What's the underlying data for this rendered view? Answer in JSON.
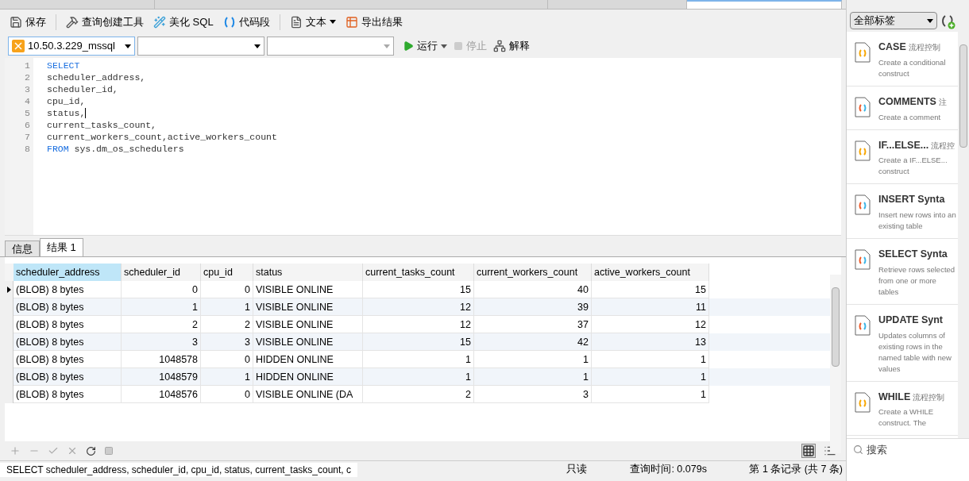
{
  "document_tabs": [
    {
      "selected": false
    },
    {
      "selected": false
    },
    {
      "selected": false
    },
    {
      "selected": true
    }
  ],
  "toolbar": [
    {
      "label": "保存",
      "kind": "save",
      "dropdown": false
    },
    {
      "label": "查询创建工具",
      "kind": "builder",
      "dropdown": false
    },
    {
      "label": "美化 SQL",
      "kind": "beautify",
      "dropdown": false
    },
    {
      "label": "代码段",
      "kind": "snippet",
      "dropdown": false
    },
    {
      "label": "文本",
      "kind": "text",
      "dropdown": true
    },
    {
      "label": "导出结果",
      "kind": "export",
      "dropdown": false
    }
  ],
  "connection": {
    "value": "10.50.3.229_mssql"
  },
  "run_buttons": [
    {
      "label": "运行",
      "kind": "run",
      "disabled": false,
      "dropdown": true
    },
    {
      "label": "停止",
      "kind": "stop",
      "disabled": true,
      "dropdown": false
    },
    {
      "label": "解释",
      "kind": "explain",
      "disabled": false,
      "dropdown": false
    }
  ],
  "editor": {
    "lines": [
      {
        "number": "1",
        "segments": [
          {
            "text": "SELECT",
            "kind": "keyword"
          }
        ]
      },
      {
        "number": "2",
        "segments": [
          {
            "text": "scheduler_address,",
            "kind": "plain"
          }
        ]
      },
      {
        "number": "3",
        "segments": [
          {
            "text": "scheduler_id,",
            "kind": "plain"
          }
        ]
      },
      {
        "number": "4",
        "segments": [
          {
            "text": "cpu_id,",
            "kind": "plain"
          }
        ]
      },
      {
        "number": "5",
        "segments": [
          {
            "text": "status,",
            "kind": "plain"
          }
        ],
        "cursor": true
      },
      {
        "number": "6",
        "segments": [
          {
            "text": "current_tasks_count,",
            "kind": "plain"
          }
        ]
      },
      {
        "number": "7",
        "segments": [
          {
            "text": "current_workers_count,active_workers_count",
            "kind": "plain"
          }
        ]
      },
      {
        "number": "8",
        "segments": [
          {
            "text": "FROM",
            "kind": "keyword"
          },
          {
            "text": " sys.dm_os_schedulers",
            "kind": "plain"
          }
        ]
      }
    ]
  },
  "result_tabs": [
    {
      "label": "信息",
      "selected": false
    },
    {
      "label": "结果 1",
      "selected": true
    }
  ],
  "table": {
    "columns": [
      {
        "label": "scheduler_address",
        "selected": true
      },
      {
        "label": "scheduler_id",
        "selected": false
      },
      {
        "label": "cpu_id",
        "selected": false
      },
      {
        "label": "status",
        "selected": false
      },
      {
        "label": "current_tasks_count",
        "selected": false
      },
      {
        "label": "current_workers_count",
        "selected": false
      },
      {
        "label": "active_workers_count",
        "selected": false
      }
    ],
    "rows": [
      {
        "selected": true,
        "cells": [
          "(BLOB) 8 bytes",
          "0",
          "0",
          "VISIBLE ONLINE",
          "15",
          "40",
          "15"
        ]
      },
      {
        "selected": false,
        "cells": [
          "(BLOB) 8 bytes",
          "1",
          "1",
          "VISIBLE ONLINE",
          "12",
          "39",
          "11"
        ]
      },
      {
        "selected": false,
        "cells": [
          "(BLOB) 8 bytes",
          "2",
          "2",
          "VISIBLE ONLINE",
          "12",
          "37",
          "12"
        ]
      },
      {
        "selected": false,
        "cells": [
          "(BLOB) 8 bytes",
          "3",
          "3",
          "VISIBLE ONLINE",
          "15",
          "42",
          "13"
        ]
      },
      {
        "selected": false,
        "cells": [
          "(BLOB) 8 bytes",
          "1048578",
          "0",
          "HIDDEN ONLINE",
          "1",
          "1",
          "1"
        ]
      },
      {
        "selected": false,
        "cells": [
          "(BLOB) 8 bytes",
          "1048579",
          "1",
          "HIDDEN ONLINE",
          "1",
          "1",
          "1"
        ]
      },
      {
        "selected": false,
        "cells": [
          "(BLOB) 8 bytes",
          "1048576",
          "0",
          "VISIBLE ONLINE (DA",
          "2",
          "3",
          "1"
        ]
      }
    ]
  },
  "status_bar": {
    "query": "SELECT scheduler_address, scheduler_id, cpu_id, status, current_tasks_count, c",
    "mode": "只读",
    "time": "查询时间: 0.079s",
    "record": "第 1 条记录 (共 7 条)"
  },
  "snippets": {
    "filter": "全部标签",
    "search_placeholder": "搜索",
    "items": [
      {
        "title": "CASE",
        "tag": "流程控制",
        "description": "Create a conditional construct",
        "kind": "flow"
      },
      {
        "title": "COMMENTS",
        "tag": "注",
        "description": "Create a comment",
        "kind": "syntax"
      },
      {
        "title": "IF...ELSE...",
        "tag": "流程控",
        "description": "Create a IF...ELSE... construct",
        "kind": "flow"
      },
      {
        "title": "INSERT Synta",
        "description": "Insert new rows into an existing table",
        "kind": "syntax"
      },
      {
        "title": "SELECT Synta",
        "description": "Retrieve rows selected from one or more tables",
        "kind": "syntax"
      },
      {
        "title": "UPDATE Synt",
        "description": "Updates columns of existing rows in the named table with new values",
        "kind": "syntax"
      },
      {
        "title": "WHILE",
        "tag": "流程控制",
        "description": "Create a WHILE construct. The",
        "kind": "flow"
      }
    ]
  }
}
